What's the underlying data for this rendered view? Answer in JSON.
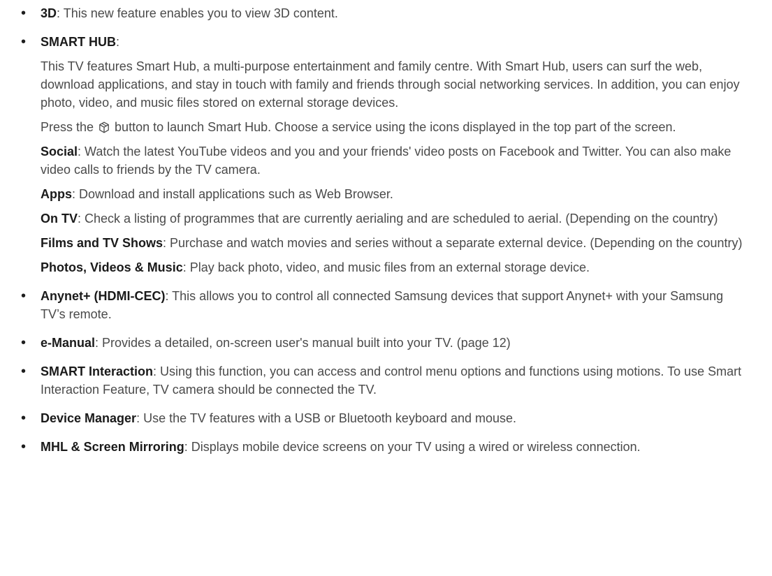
{
  "features": [
    {
      "term": "3D",
      "text": ": This new feature enables you to view 3D content."
    },
    {
      "term": "SMART HUB",
      "text": ":"
    },
    {
      "term": "Anynet+ (HDMI-CEC)",
      "text": ": This allows you to control all connected Samsung devices that support Anynet+ with your Samsung TV’s remote."
    },
    {
      "term": "e-Manual",
      "text": ": Provides a detailed, on-screen user's manual built into your TV. (page 12)"
    },
    {
      "term": "SMART Interaction",
      "text": ": Using this function, you can access and control menu options and functions using motions. To use Smart Interaction Feature, TV camera should be connected the TV."
    },
    {
      "term": "Device Manager",
      "text": ": Use the TV features with a USB or Bluetooth keyboard and mouse."
    },
    {
      "term": "MHL & Screen Mirroring",
      "text": ": Displays mobile device screens on your TV using a wired or wireless connection."
    }
  ],
  "smart_hub": {
    "intro": "This TV features Smart Hub, a multi-purpose entertainment and family centre. With Smart Hub, users can surf the web, download applications, and stay in touch with family and friends through social networking services. In addition, you can enjoy photo, video, and music files stored on external storage devices.",
    "press_before": "Press the ",
    "press_icon": "smart-hub-button-icon",
    "press_after": " button to launch Smart Hub. Choose a service using the icons displayed in the top part of the screen.",
    "services": [
      {
        "term": "Social",
        "text": ": Watch the latest YouTube videos and you and your friends' video posts on Facebook and Twitter. You can also make video calls to friends by the TV camera."
      },
      {
        "term": "Apps",
        "text": ": Download and install applications such as Web Browser."
      },
      {
        "term": "On TV",
        "text": ": Check a listing of programmes that are currently aerialing and are scheduled to aerial. (Depending on the country)"
      },
      {
        "term": "Films and TV Shows",
        "text": ": Purchase and watch movies and series without a separate external device. (Depending on the country)"
      },
      {
        "term": "Photos, Videos & Music",
        "text": ": Play back photo, video, and music files from an external storage device."
      }
    ]
  },
  "bullet_char": "•"
}
